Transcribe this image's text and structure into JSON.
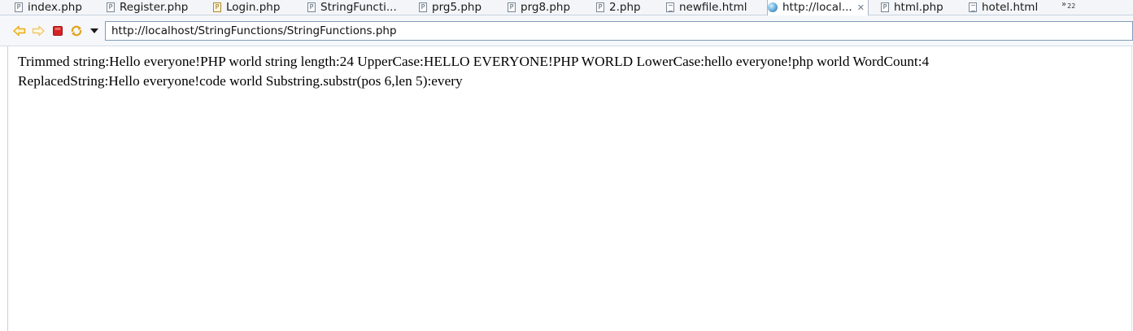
{
  "tabs": [
    {
      "label": "index.php",
      "icon": "php-file-icon"
    },
    {
      "label": "Register.php",
      "icon": "php-file-icon"
    },
    {
      "label": "Login.php",
      "icon": "php-file-icon"
    },
    {
      "label": "StringFuncti...",
      "icon": "php-file-icon"
    },
    {
      "label": "prg5.php",
      "icon": "php-file-icon"
    },
    {
      "label": "prg8.php",
      "icon": "php-file-icon"
    },
    {
      "label": "2.php",
      "icon": "php-file-icon"
    },
    {
      "label": "newfile.html",
      "icon": "html-file-icon"
    },
    {
      "label": "http://local...",
      "icon": "globe-icon",
      "active": true
    },
    {
      "label": "html.php",
      "icon": "php-file-icon"
    },
    {
      "label": "hotel.html",
      "icon": "html-file-icon"
    }
  ],
  "tab_overflow": {
    "symbol": "»",
    "count": "22"
  },
  "toolbar": {
    "url": "http://localhost/StringFunctions/StringFunctions.php"
  },
  "page": {
    "line1": "Trimmed string:Hello everyone!PHP world string length:24 UpperCase:HELLO EVERYONE!PHP WORLD LowerCase:hello everyone!php world WordCount:4",
    "line2": "ReplacedString:Hello everyone!code world Substring.substr(pos 6,len 5):every"
  },
  "colors": {
    "back_forward": "#e8a91a",
    "stop": "#d42424",
    "refresh": "#e0a31c"
  }
}
